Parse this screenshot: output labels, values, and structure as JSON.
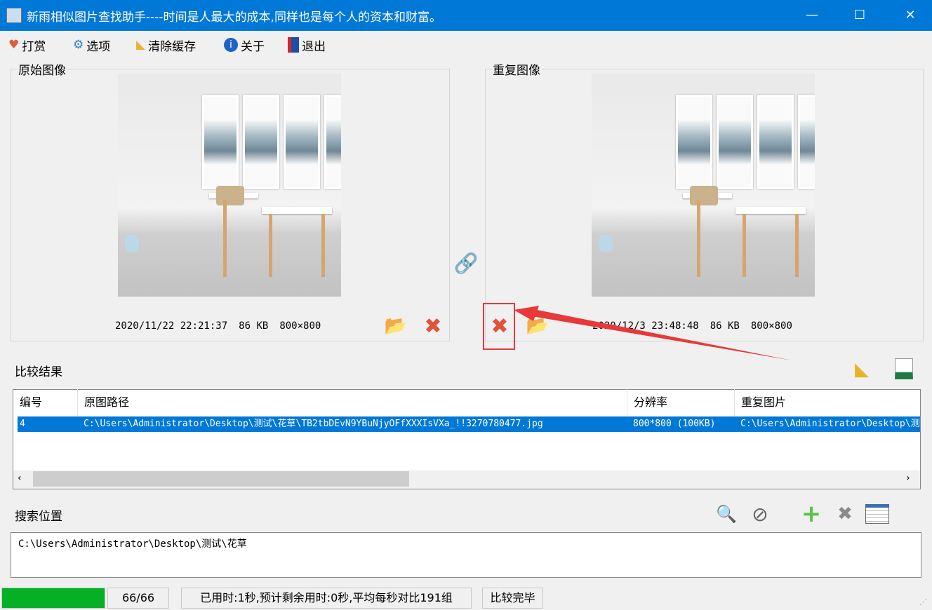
{
  "window": {
    "title": "新雨相似图片查找助手----时间是人最大的成本,同样也是每个人的资本和财富。",
    "minimize": "—",
    "maximize": "☐",
    "close": "✕"
  },
  "menu": [
    {
      "label": "打赏",
      "icon": "gift-icon"
    },
    {
      "label": "选项",
      "icon": "gear-icon"
    },
    {
      "label": "清除缓存",
      "icon": "broom-icon"
    },
    {
      "label": "关于",
      "icon": "info-icon"
    },
    {
      "label": "退出",
      "icon": "exit-door-icon"
    }
  ],
  "original": {
    "label": "原始图像",
    "date": "2020/11/22 22:21:37",
    "size": "86 KB",
    "dims": "800×800"
  },
  "duplicate": {
    "label": "重复图像",
    "date": "2020/12/3 23:48:48",
    "size": "86 KB",
    "dims": "800×800"
  },
  "results": {
    "label": "比较结果",
    "columns": [
      "编号",
      "原图路径",
      "分辨率",
      "重复图片"
    ],
    "rows": [
      {
        "id": "4",
        "path": "C:\\Users\\Administrator\\Desktop\\测试\\花草\\TB2tbDEvN9YBuNjyOFfXXXIsVXa_!!3270780477.jpg",
        "resolution": "800*800 (100KB)",
        "dup": "C:\\Users\\Administrator\\Desktop\\测试\\花草\\"
      }
    ]
  },
  "search": {
    "label": "搜索位置",
    "paths": "C:\\Users\\Administrator\\Desktop\\测试\\花草"
  },
  "status": {
    "progress_percent": 100,
    "count": "66/66",
    "timing": "已用时:1秒,预计剩余用时:0秒,平均每秒对比191组",
    "state": "比较完毕"
  },
  "colors": {
    "accent": "#0078d7",
    "selection": "#0078d7",
    "progress": "#06b025",
    "annotation": "#e8383a"
  }
}
